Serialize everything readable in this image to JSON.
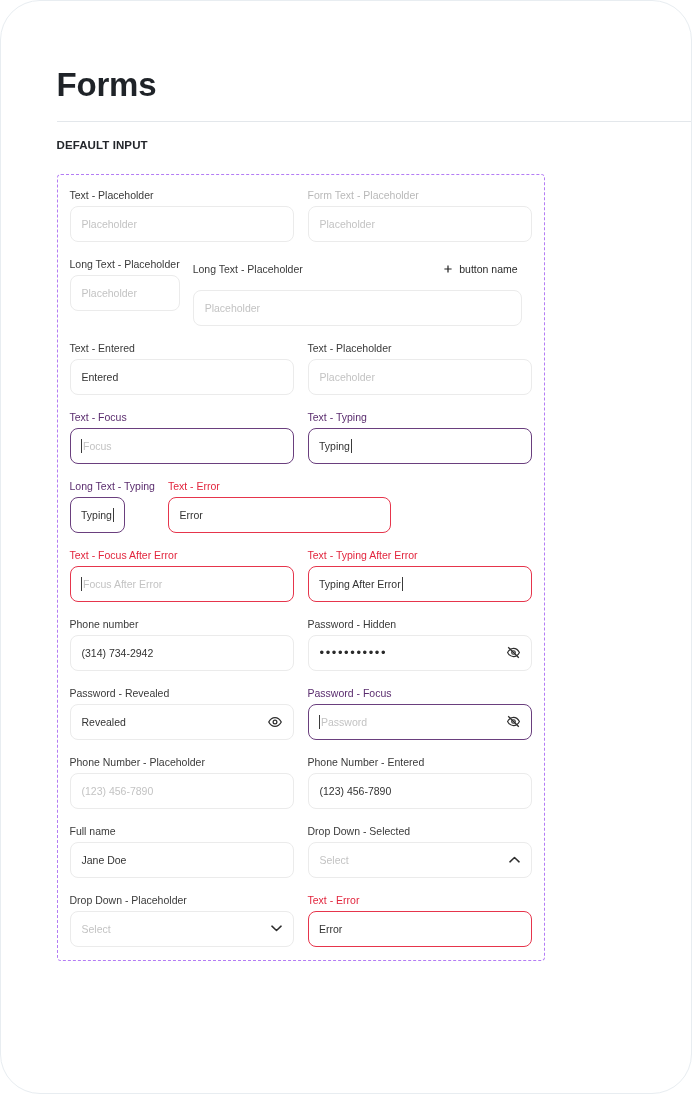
{
  "page": {
    "title": "Forms"
  },
  "section": {
    "title": "DEFAULT INPUT"
  },
  "rows": [
    [
      {
        "kind": "text",
        "label": "Text - Placeholder",
        "placeholder": "Placeholder",
        "disabled": false,
        "focused": false,
        "error": false
      },
      {
        "kind": "text",
        "label": "Form Text - Placeholder",
        "placeholder": "Placeholder",
        "disabled": true,
        "focused": false,
        "error": false
      }
    ],
    [
      {
        "kind": "text",
        "label": "Long Text - Placeholder",
        "placeholder": "Placeholder",
        "disabled": false,
        "focused": false,
        "error": false
      },
      {
        "kind": "text",
        "label": "Long Text - Placeholder",
        "action": "button name",
        "placeholder": "Placeholder",
        "disabled": false,
        "focused": false,
        "error": false
      }
    ],
    [
      {
        "kind": "text",
        "label": "Text - Entered",
        "value": "Entered",
        "disabled": false,
        "focused": false,
        "error": false
      },
      {
        "kind": "text",
        "label": "Text - Placeholder",
        "placeholder": "Placeholder",
        "disabled": false,
        "focused": false,
        "error": false
      }
    ],
    [
      {
        "kind": "text",
        "label": "Text - Focus",
        "placeholder": "Focus",
        "disabled": false,
        "focused": true,
        "error": false
      },
      {
        "kind": "text",
        "label": "Text - Typing",
        "value": "Typing",
        "disabled": false,
        "focused": true,
        "error": false
      }
    ],
    [
      {
        "kind": "text",
        "label": "Long Text - Typing",
        "value": "Typing",
        "disabled": false,
        "focused": true,
        "error": false
      },
      {
        "kind": "text",
        "label": "Text - Error",
        "value": "Error",
        "disabled": false,
        "focused": false,
        "error": true
      }
    ],
    [
      {
        "kind": "text",
        "label": "Text - Focus After Error",
        "placeholder": "Focus After Error",
        "disabled": false,
        "focused": true,
        "error": true
      },
      {
        "kind": "text",
        "label": "Text - Typing After Error",
        "value": "Typing After Error",
        "disabled": false,
        "focused": true,
        "error": true
      }
    ],
    [
      {
        "kind": "text",
        "label": "Phone number",
        "value": "(314) 734-2942",
        "disabled": false,
        "focused": false,
        "error": false
      },
      {
        "kind": "password",
        "label": "Password - Hidden",
        "value": "•••••••••••",
        "revealed": false,
        "disabled": false,
        "focused": false,
        "error": false
      }
    ],
    [
      {
        "kind": "password",
        "label": "Password - Revealed",
        "value": "Revealed",
        "revealed": true,
        "disabled": false,
        "focused": false,
        "error": false
      },
      {
        "kind": "password",
        "label": "Password - Focus",
        "placeholder": "Password",
        "revealed": false,
        "disabled": false,
        "focused": true,
        "error": false
      }
    ],
    [
      {
        "kind": "text",
        "label": "Phone Number - Placeholder",
        "placeholder": "(123) 456-7890",
        "disabled": false,
        "focused": false,
        "error": false
      },
      {
        "kind": "text",
        "label": "Phone Number - Entered",
        "value": "(123) 456-7890",
        "disabled": false,
        "focused": false,
        "error": false
      }
    ],
    [
      {
        "kind": "text",
        "label": "Full name",
        "value": "Jane Doe",
        "disabled": false,
        "focused": false,
        "error": false
      },
      {
        "kind": "dropdown",
        "label": "Drop Down - Selected",
        "placeholder": "Select",
        "expanded": true,
        "disabled": false,
        "focused": false,
        "error": false
      }
    ],
    [
      {
        "kind": "dropdown",
        "label": "Drop Down - Placeholder",
        "placeholder": "Select",
        "expanded": false,
        "disabled": false,
        "focused": false,
        "error": false
      },
      {
        "kind": "text",
        "label": "Text - Error",
        "value": "Error",
        "disabled": false,
        "focused": false,
        "error": true
      }
    ]
  ]
}
